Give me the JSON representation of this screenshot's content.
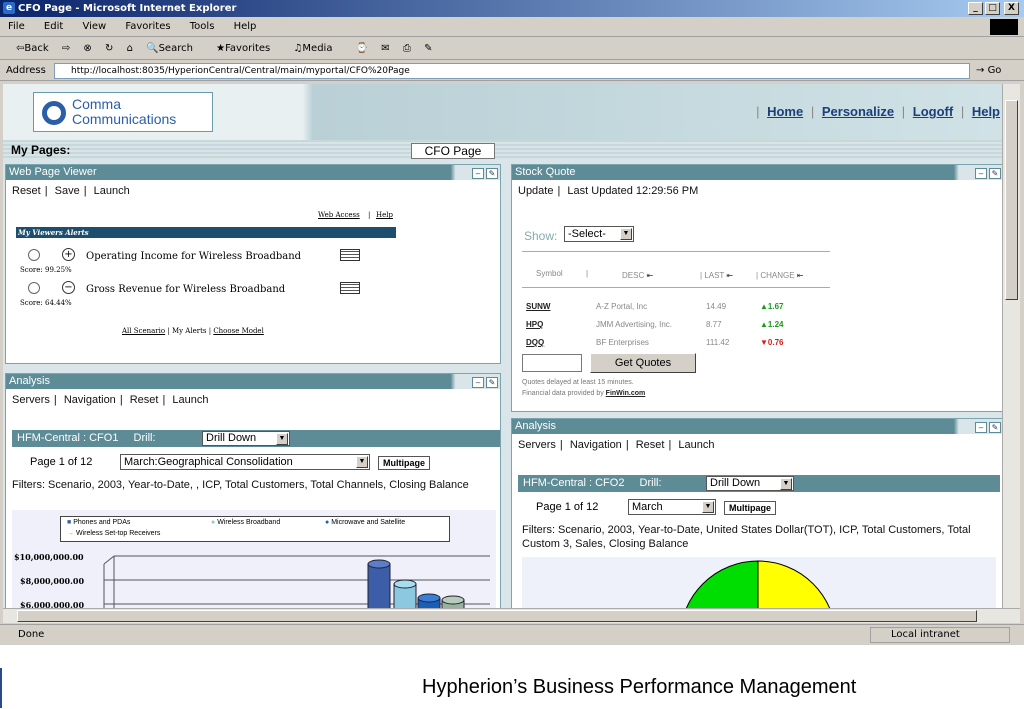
{
  "window": {
    "title": "CFO Page - Microsoft Internet Explorer",
    "minimize": "_",
    "maximize": "□",
    "close": "X"
  },
  "menu": [
    "File",
    "Edit",
    "View",
    "Favorites",
    "Tools",
    "Help"
  ],
  "toolbar": {
    "back": "⇦Back",
    "forward": "⇨",
    "search": "Search",
    "favorites": "Favorites",
    "media": "Media"
  },
  "address": {
    "label": "Address",
    "url": "http://localhost:8035/HyperionCentral/Central/main/myportal/CFO%20Page",
    "go": "Go"
  },
  "header": {
    "logo_line1": "Comma",
    "logo_line2": "Communications",
    "nav": [
      "Home",
      "Personalize",
      "Logoff",
      "Help"
    ]
  },
  "mypages": {
    "label": "My Pages:",
    "tab": "CFO Page"
  },
  "web_viewer": {
    "title": "Web Page Viewer",
    "links": [
      "Reset",
      "Save",
      "Launch"
    ],
    "top_links": [
      "Web Access",
      "Help"
    ],
    "alerts_title": "My Viewers Alerts",
    "alerts": [
      {
        "text": "Operating Income for Wireless Broadband",
        "score": "Score: 99.25%",
        "sign": "+"
      },
      {
        "text": "Gross Revenue for Wireless Broadband",
        "score": "Score: 64.44%",
        "sign": "−"
      }
    ],
    "bottom_links": [
      "All Scenario",
      "My Alerts",
      "Choose Model"
    ]
  },
  "stock": {
    "title": "Stock Quote",
    "update": "Update",
    "last_updated": "Last Updated 12:29:56 PM",
    "show_label": "Show:",
    "show_value": "-Select-",
    "col_symbol": "Symbol",
    "col_desc": "DESC",
    "col_last": "LAST",
    "col_change": "CHANGE",
    "rows": [
      {
        "symbol": "SUNW",
        "desc": "A-Z Portal, Inc",
        "last": "14.49",
        "change": "1.67",
        "dir": "up"
      },
      {
        "symbol": "HPQ",
        "desc": "JMM Advertising, Inc.",
        "last": "8.77",
        "change": "1.24",
        "dir": "up"
      },
      {
        "symbol": "DQQ",
        "desc": "BF Enterprises",
        "last": "111.42",
        "change": "0.76",
        "dir": "down"
      }
    ],
    "get_quotes": "Get Quotes",
    "disclaimer1": "Quotes delayed at least 15 minutes.",
    "disclaimer2": "Financial data provided by",
    "provider": "FinWin.com"
  },
  "analysis1": {
    "title": "Analysis",
    "links": [
      "Servers",
      "Navigation",
      "Reset",
      "Launch"
    ],
    "bar_label": "HFM-Central : CFO1",
    "drill_label": "Drill:",
    "drill_value": "Drill Down",
    "page": "Page 1 of 12",
    "page_select": "March:Geographical Consolidation",
    "multipage": "Multipage",
    "filters": "Filters: Scenario, 2003, Year-to-Date, , ICP, Total Customers, Total Channels, Closing Balance",
    "legend": [
      "Phones and PDAs",
      "Wireless Broadband",
      "Microwave and Satellite",
      "Wireless Set-top Receivers"
    ],
    "yticks": [
      "$10,000,000.00",
      "$8,000,000.00",
      "$6,000,000.00"
    ]
  },
  "analysis2": {
    "title": "Analysis",
    "links": [
      "Servers",
      "Navigation",
      "Reset",
      "Launch"
    ],
    "bar_label": "HFM-Central : CFO2",
    "drill_label": "Drill:",
    "drill_value": "Drill Down",
    "page": "Page 1 of 12",
    "page_select": "March",
    "multipage": "Multipage",
    "filters": "Filters: Scenario, 2003, Year-to-Date, United States Dollar(TOT), ICP, Total Customers, Total Custom 3, Sales, Closing Balance"
  },
  "status": {
    "text": "Done",
    "zone": "Local intranet"
  },
  "caption": "Hypherion’s Business Performance Management",
  "colors": {
    "portlet_title": "#5d8b96",
    "green": "#00dd00",
    "yellow": "#ffff00"
  }
}
